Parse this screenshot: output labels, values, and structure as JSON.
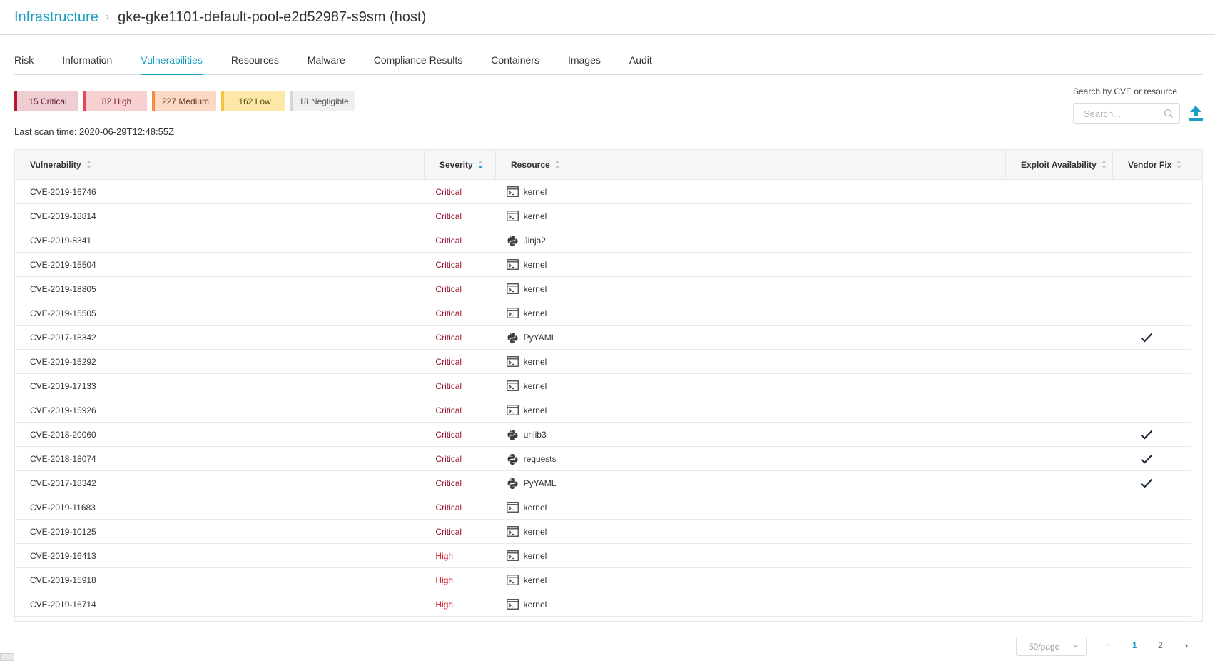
{
  "breadcrumb": {
    "root": "Infrastructure",
    "separator": "›",
    "current": "gke-gke1101-default-pool-e2d52987-s9sm (host)"
  },
  "tabs": [
    {
      "label": "Risk",
      "active": false
    },
    {
      "label": "Information",
      "active": false
    },
    {
      "label": "Vulnerabilities",
      "active": true
    },
    {
      "label": "Resources",
      "active": false
    },
    {
      "label": "Malware",
      "active": false
    },
    {
      "label": "Compliance Results",
      "active": false
    },
    {
      "label": "Containers",
      "active": false
    },
    {
      "label": "Images",
      "active": false
    },
    {
      "label": "Audit",
      "active": false
    }
  ],
  "severity_counts": {
    "critical": "15 Critical",
    "high": "82 High",
    "medium": "227 Medium",
    "low": "162 Low",
    "negligible": "18 Negligible"
  },
  "scan_time": "Last scan time: 2020-06-29T12:48:55Z",
  "search": {
    "label": "Search by CVE or resource",
    "placeholder": "Search..."
  },
  "table": {
    "headers": {
      "vulnerability": "Vulnerability",
      "severity": "Severity",
      "resource": "Resource",
      "exploit": "Exploit Availability",
      "vendor_fix": "Vendor Fix"
    },
    "rows": [
      {
        "cve": "CVE-2019-16746",
        "severity": "Critical",
        "resource": "kernel",
        "resource_type": "terminal-icon",
        "fix": false
      },
      {
        "cve": "CVE-2019-18814",
        "severity": "Critical",
        "resource": "kernel",
        "resource_type": "terminal-icon",
        "fix": false
      },
      {
        "cve": "CVE-2019-8341",
        "severity": "Critical",
        "resource": "Jinja2",
        "resource_type": "python-icon",
        "fix": false
      },
      {
        "cve": "CVE-2019-15504",
        "severity": "Critical",
        "resource": "kernel",
        "resource_type": "terminal-icon",
        "fix": false
      },
      {
        "cve": "CVE-2019-18805",
        "severity": "Critical",
        "resource": "kernel",
        "resource_type": "terminal-icon",
        "fix": false
      },
      {
        "cve": "CVE-2019-15505",
        "severity": "Critical",
        "resource": "kernel",
        "resource_type": "terminal-icon",
        "fix": false
      },
      {
        "cve": "CVE-2017-18342",
        "severity": "Critical",
        "resource": "PyYAML",
        "resource_type": "python-icon",
        "fix": true
      },
      {
        "cve": "CVE-2019-15292",
        "severity": "Critical",
        "resource": "kernel",
        "resource_type": "terminal-icon",
        "fix": false
      },
      {
        "cve": "CVE-2019-17133",
        "severity": "Critical",
        "resource": "kernel",
        "resource_type": "terminal-icon",
        "fix": false
      },
      {
        "cve": "CVE-2019-15926",
        "severity": "Critical",
        "resource": "kernel",
        "resource_type": "terminal-icon",
        "fix": false
      },
      {
        "cve": "CVE-2018-20060",
        "severity": "Critical",
        "resource": "urllib3",
        "resource_type": "python-icon",
        "fix": true
      },
      {
        "cve": "CVE-2018-18074",
        "severity": "Critical",
        "resource": "requests",
        "resource_type": "python-icon",
        "fix": true
      },
      {
        "cve": "CVE-2017-18342",
        "severity": "Critical",
        "resource": "PyYAML",
        "resource_type": "python-icon",
        "fix": true
      },
      {
        "cve": "CVE-2019-11683",
        "severity": "Critical",
        "resource": "kernel",
        "resource_type": "terminal-icon",
        "fix": false
      },
      {
        "cve": "CVE-2019-10125",
        "severity": "Critical",
        "resource": "kernel",
        "resource_type": "terminal-icon",
        "fix": false
      },
      {
        "cve": "CVE-2019-16413",
        "severity": "High",
        "resource": "kernel",
        "resource_type": "terminal-icon",
        "fix": false
      },
      {
        "cve": "CVE-2019-15918",
        "severity": "High",
        "resource": "kernel",
        "resource_type": "terminal-icon",
        "fix": false
      },
      {
        "cve": "CVE-2019-16714",
        "severity": "High",
        "resource": "kernel",
        "resource_type": "terminal-icon",
        "fix": false
      }
    ]
  },
  "pagination": {
    "page_size": "50/page",
    "pages": [
      "1",
      "2"
    ],
    "current_page": "1",
    "prev": "‹",
    "next": "›"
  },
  "colors": {
    "accent": "#1a9ec4",
    "critical_text": "#9e1a33",
    "high_text": "#d8222c"
  }
}
